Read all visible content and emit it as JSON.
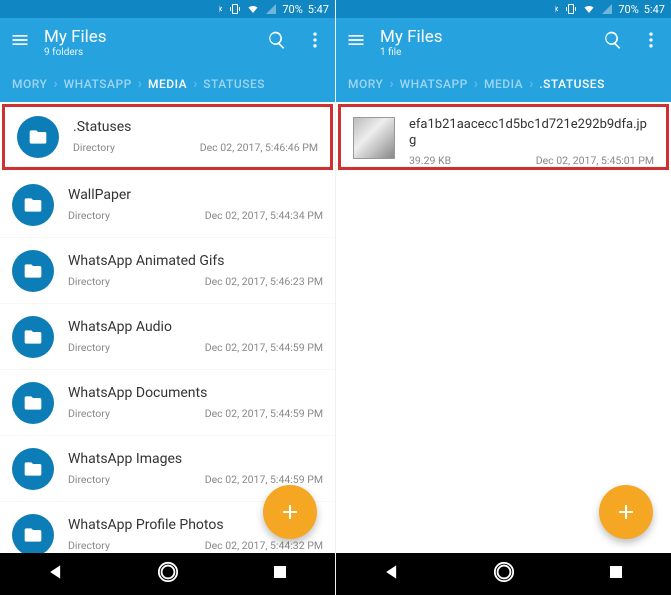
{
  "status_bar": {
    "battery_pct": "70%",
    "time": "5:47"
  },
  "left": {
    "app_title": "My Files",
    "subtitle": "9 folders",
    "breadcrumb": [
      "MORY",
      "WHATSAPP",
      "MEDIA",
      "STATUSES"
    ],
    "breadcrumb_active_index": 2,
    "items": [
      {
        "name": ".Statuses",
        "type_label": "Directory",
        "timestamp": "Dec 02, 2017, 5:46:46 PM",
        "highlighted": true
      },
      {
        "name": "WallPaper",
        "type_label": "Directory",
        "timestamp": "Dec 02, 2017, 5:44:34 PM"
      },
      {
        "name": "WhatsApp Animated Gifs",
        "type_label": "Directory",
        "timestamp": "Dec 02, 2017, 5:46:23 PM"
      },
      {
        "name": "WhatsApp Audio",
        "type_label": "Directory",
        "timestamp": "Dec 02, 2017, 5:44:59 PM"
      },
      {
        "name": "WhatsApp Documents",
        "type_label": "Directory",
        "timestamp": "Dec 02, 2017, 5:44:59 PM"
      },
      {
        "name": "WhatsApp Images",
        "type_label": "Directory",
        "timestamp": "Dec 02, 2017, 5:44:59 PM"
      },
      {
        "name": "WhatsApp Profile Photos",
        "type_label": "Directory",
        "timestamp": "Dec 02, 2017, 5:44:32 PM"
      }
    ]
  },
  "right": {
    "app_title": "My Files",
    "subtitle": "1 file",
    "breadcrumb": [
      "MORY",
      "WHATSAPP",
      "MEDIA",
      ".STATUSES"
    ],
    "breadcrumb_active_index": 3,
    "items": [
      {
        "name": "efa1b21aacecc1d5bc1d721e292b9dfa.jpg",
        "size": "39.29 KB",
        "timestamp": "Dec 02, 2017, 5:45:01 PM",
        "highlighted": true
      }
    ]
  }
}
